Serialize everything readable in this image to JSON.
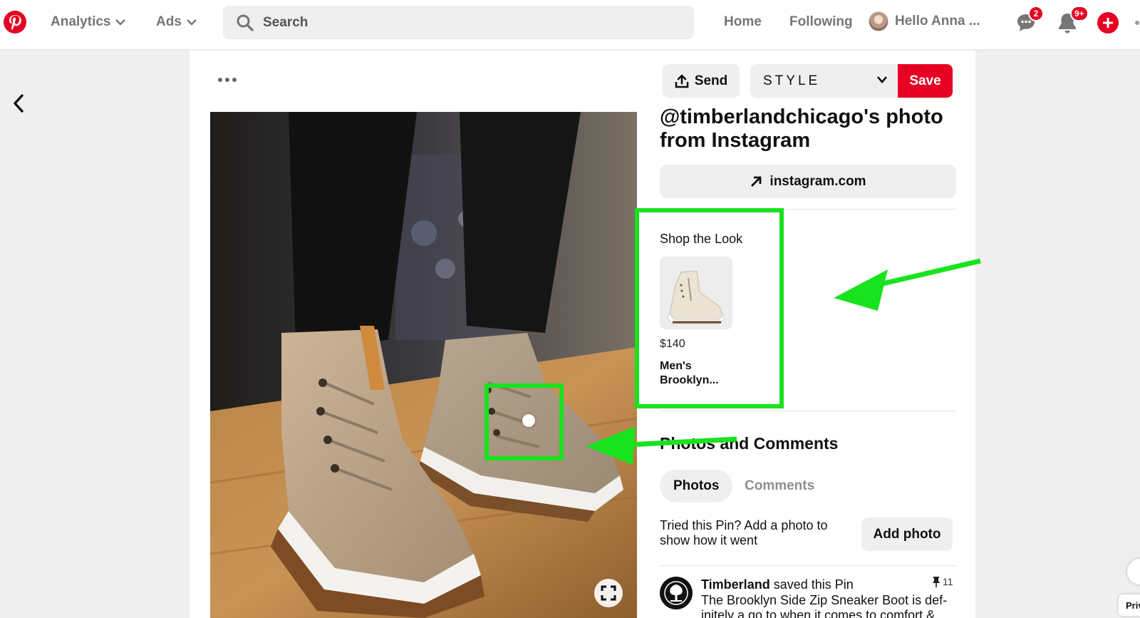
{
  "nav": {
    "analytics_label": "Analytics",
    "ads_label": "Ads",
    "search_placeholder": "Search",
    "home_label": "Home",
    "following_label": "Following",
    "user_label": "Hello Anna ...",
    "messages_badge": "2",
    "notifications_badge": "9+",
    "brand_color": "#e60023"
  },
  "pin_actions": {
    "send_label": "Send",
    "board_label": "STYLE",
    "save_label": "Save"
  },
  "pin": {
    "title": "@timberlandchicago's photo from Instagram",
    "link_label": "instagram.com"
  },
  "shop": {
    "title": "Shop the Look",
    "product_price": "$140",
    "product_name": "Men's Brooklyn..."
  },
  "comments_section": {
    "title": "Photos and Comments",
    "tabs": [
      {
        "label": "Photos",
        "active": true
      },
      {
        "label": "Comments",
        "active": false
      }
    ],
    "prompt": "Tried this Pin? Add a photo to show how it went",
    "add_photo_label": "Add photo"
  },
  "comment": {
    "author": "Timberland",
    "action": "saved this Pin",
    "pin_count": "11",
    "text": "The Brooklyn Side Zip Sneaker Boot is def-initely a go to when it comes to comfort &"
  },
  "footer": {
    "privacy_label": "Priv"
  },
  "annotation_color": "#19e21e"
}
